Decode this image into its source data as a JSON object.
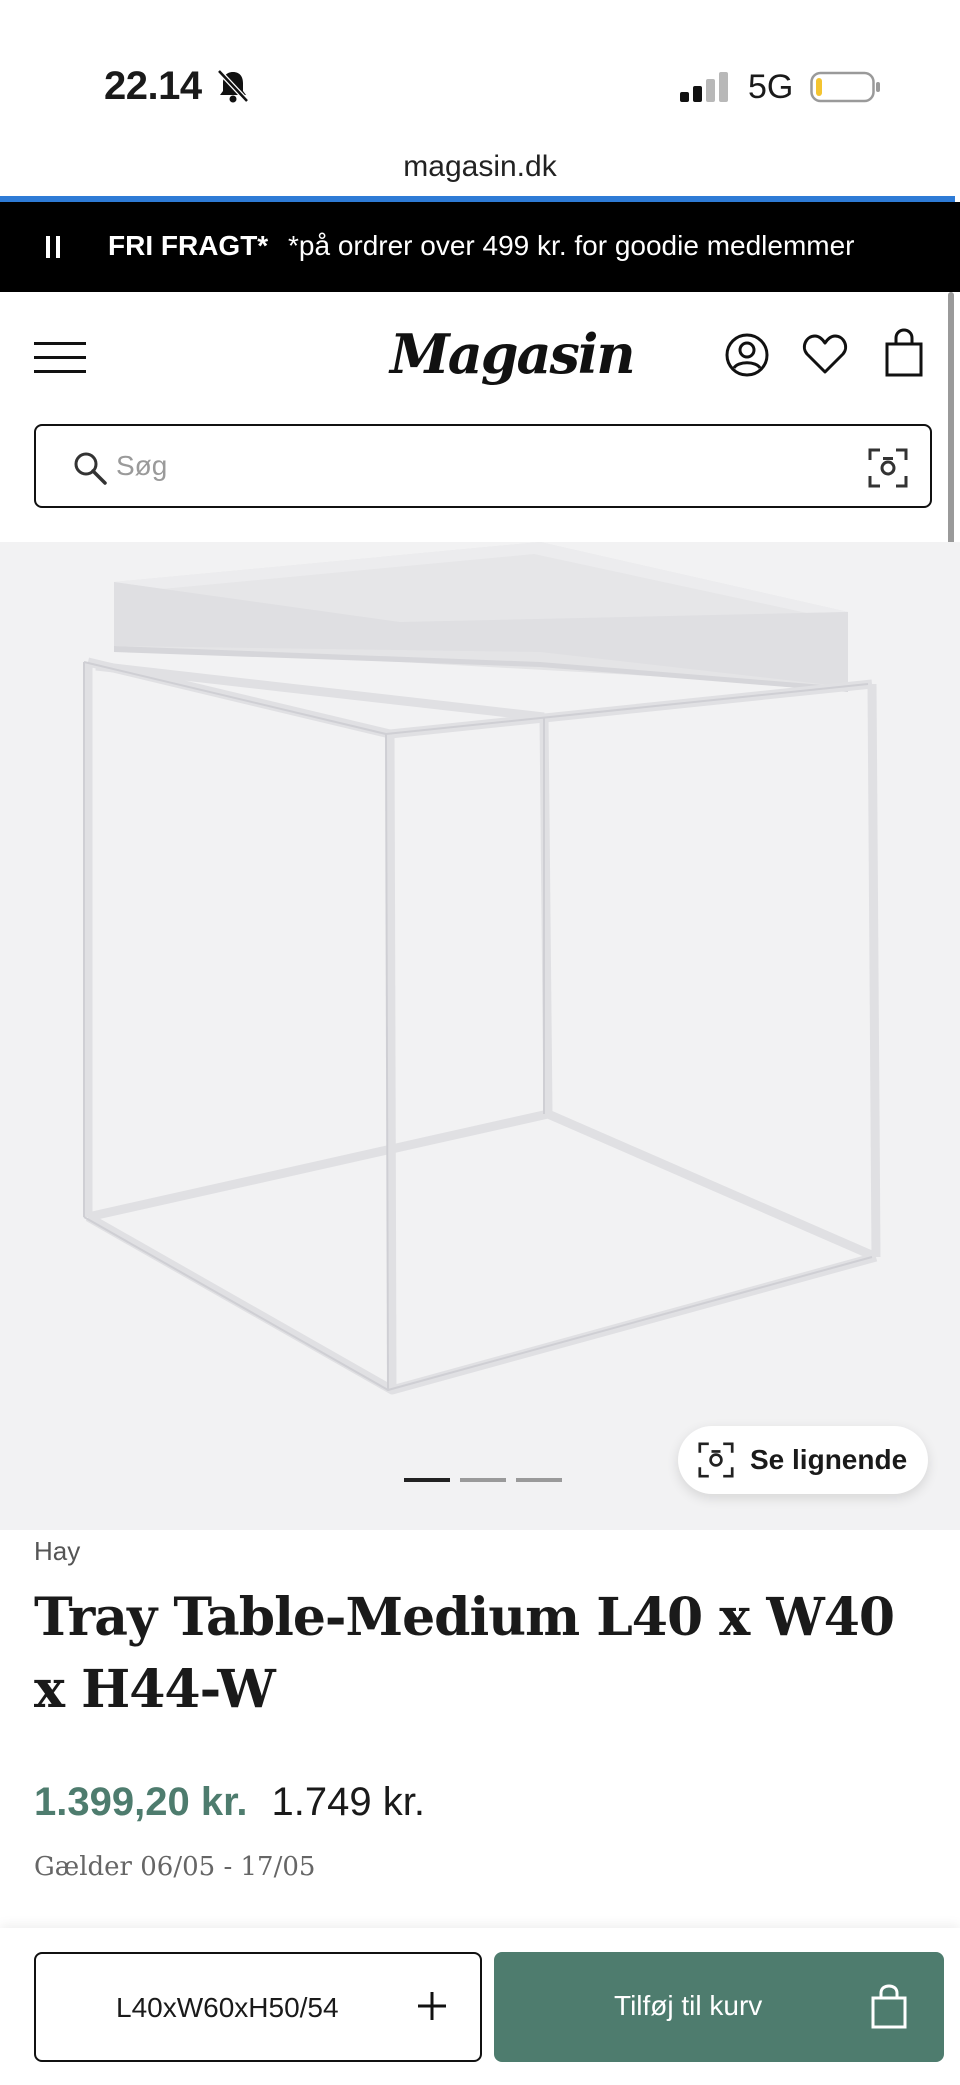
{
  "status_bar": {
    "time": "22.14",
    "network": "5G",
    "url": "magasin.dk"
  },
  "promo": {
    "strong": "FRI FRAGT*",
    "text": "*på ordrer over 499 kr. for goodie medlemmer"
  },
  "header": {
    "logo": "Magasin",
    "search_placeholder": "Søg"
  },
  "gallery": {
    "image_count": 3,
    "active_index": 0,
    "similar_label": "Se lignende"
  },
  "product": {
    "brand": "Hay",
    "title": "Tray Table-Medium L40 x W40 x H44-W",
    "sale_price": "1.399,20 kr.",
    "regular_price": "1.749 kr.",
    "validity": "Gælder 06/05 - 17/05"
  },
  "bottom_bar": {
    "size_label": "L40xW60xH50/54",
    "add_to_cart_label": "Tilføj til kurv"
  },
  "colors": {
    "accent": "#4e7c6e",
    "promo_bg": "#000000",
    "image_bg": "#f2f2f3",
    "progress": "#2e7bd6"
  }
}
